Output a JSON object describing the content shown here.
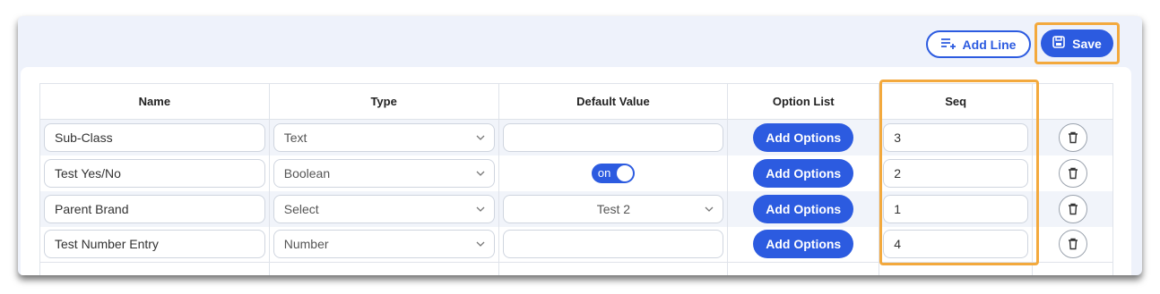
{
  "toolbar": {
    "add_line_label": "Add Line",
    "add_line_icon": "list-add-icon",
    "save_label": "Save",
    "save_icon": "floppy-disk-icon"
  },
  "table": {
    "columns": [
      "Name",
      "Type",
      "Default Value",
      "Option List",
      "Seq",
      ""
    ],
    "rows": [
      {
        "name": "Sub-Class",
        "type": "Text",
        "default_kind": "input",
        "default_value": "",
        "option_button": "Add Options",
        "seq": "3"
      },
      {
        "name": "Test Yes/No",
        "type": "Boolean",
        "default_kind": "toggle",
        "default_value": "on",
        "option_button": "Add Options",
        "seq": "2"
      },
      {
        "name": "Parent Brand",
        "type": "Select",
        "default_kind": "select",
        "default_value": "Test 2",
        "option_button": "Add Options",
        "seq": "1"
      },
      {
        "name": "Test Number Entry",
        "type": "Number",
        "default_kind": "input",
        "default_value": "",
        "option_button": "Add Options",
        "seq": "4"
      }
    ]
  },
  "colors": {
    "accent": "#2c5be0",
    "highlight": "#f3a93d",
    "panel_bg": "#eef2fb",
    "row_stripe": "#f1f4fa"
  }
}
